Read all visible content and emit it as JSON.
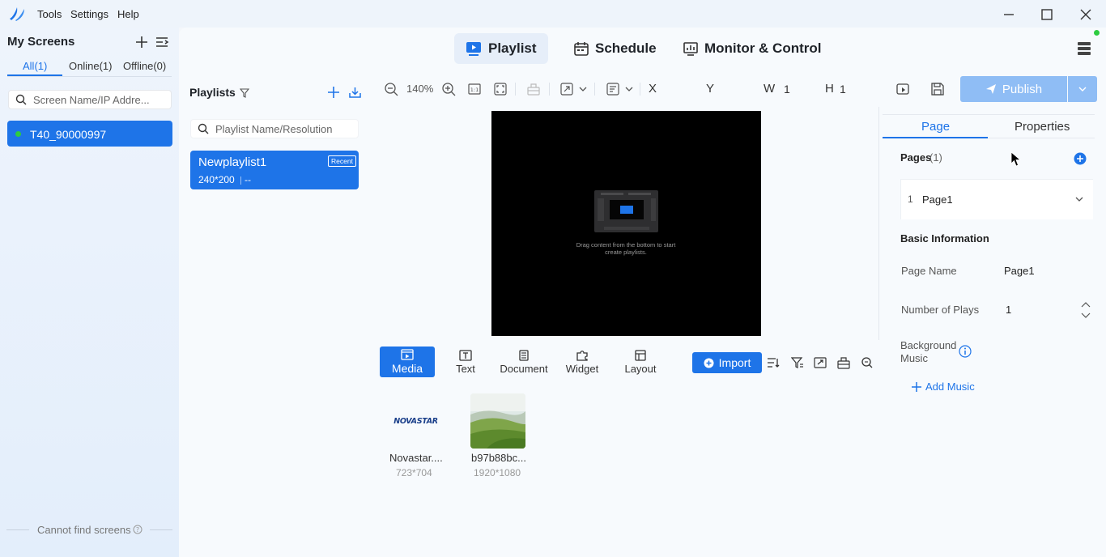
{
  "menu": {
    "tools": "Tools",
    "settings": "Settings",
    "help": "Help"
  },
  "sidebar": {
    "title": "My Screens",
    "filters": [
      {
        "label": "All(1)"
      },
      {
        "label": "Online(1)"
      },
      {
        "label": "Offline(0)"
      }
    ],
    "search_placeholder": "Screen Name/IP Addre...",
    "screens": [
      {
        "name": "T40_90000997",
        "status": "online"
      }
    ],
    "footer": "Cannot find screens"
  },
  "nav": {
    "playlist": "Playlist",
    "schedule": "Schedule",
    "monitor": "Monitor & Control"
  },
  "playlists": {
    "title": "Playlists",
    "search_placeholder": "Playlist Name/Resolution",
    "items": [
      {
        "name": "Newplaylist1",
        "badge": "Recent",
        "resolution": "240*200",
        "extra": "--"
      }
    ]
  },
  "toolbar": {
    "zoom": "140%",
    "x_label": "X",
    "y_label": "Y",
    "w_label": "W",
    "w_value": "1",
    "h_label": "H",
    "h_value": "1",
    "publish": "Publish"
  },
  "canvas": {
    "hint_line1": "Drag content from the bottom to start",
    "hint_line2": "create playlists."
  },
  "bottom_tabs": {
    "media": "Media",
    "text": "Text",
    "document": "Document",
    "widget": "Widget",
    "layout": "Layout",
    "import": "Import"
  },
  "media": [
    {
      "name": "Novastar....",
      "size": "723*704",
      "logo_text": "NOVASTAR"
    },
    {
      "name": "b97b88bc...",
      "size": "1920*1080"
    }
  ],
  "right": {
    "tab_page": "Page",
    "tab_properties": "Properties",
    "pages_label": "Pages",
    "pages_count": "(1)",
    "page_index": "1",
    "page_name": "Page1",
    "basic_info": "Basic Information",
    "page_name_label": "Page Name",
    "page_name_value": "Page1",
    "plays_label": "Number of Plays",
    "plays_value": "1",
    "bg_music_line1": "Background",
    "bg_music_line2": "Music",
    "add_music": "Add Music"
  },
  "colors": {
    "accent": "#1e74e8",
    "online": "#2ecc40",
    "publish_disabled": "#8fbdf5"
  }
}
